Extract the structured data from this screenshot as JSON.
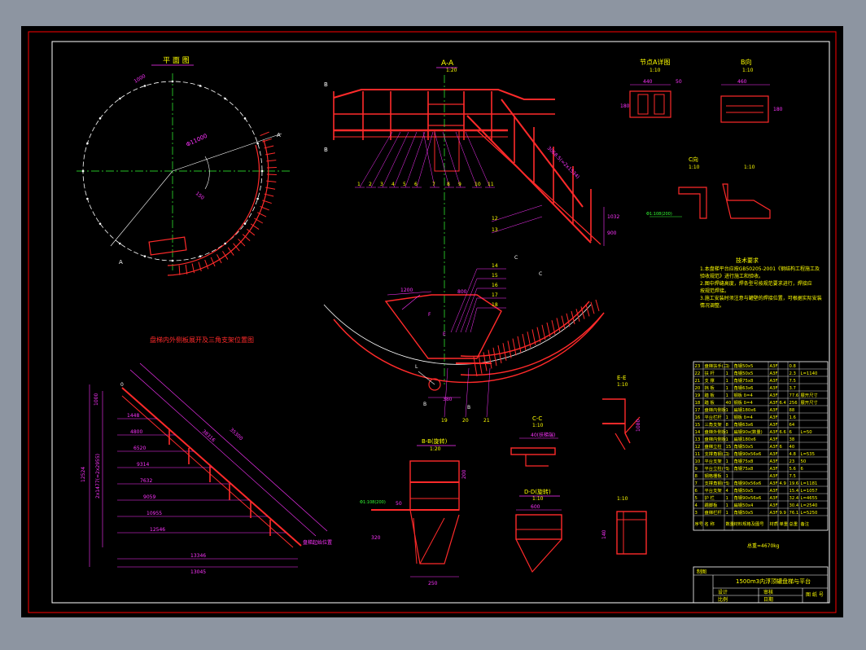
{
  "colors": {
    "background": "#000000",
    "frame": "#ff0000",
    "geometry": "#ff2a2a",
    "dimension": "#ff33ff",
    "text": "#ffff00",
    "centerline": "#33ff33",
    "leader": "#ffffff",
    "table": "#ffffff"
  },
  "views": {
    "plan_title": "平 面 图",
    "section_aa_title": "A-A",
    "section_aa_scale": "1:20",
    "node_title": "节点A详图",
    "node_scale": "1:10",
    "b_title": "B向",
    "b_scale": "1:10",
    "c_label": "C向",
    "c_scale": "1:10",
    "d_scale": "1:10",
    "unfold_title": "盘梯内外侧板展开及三角支架位置图",
    "bb_title": "B-B(旋转)",
    "bb_scale": "1:20",
    "cc_title": "C-C",
    "cc_scale": "1:10",
    "dd_title": "D-D(旋转)",
    "dd_scale": "1:10",
    "ee_title": "E-E",
    "ee_scale": "1:10",
    "f_scale": "1:10"
  },
  "notes": {
    "title": "技术要求",
    "lines": [
      "1.本盘梯平台应按GB50205-2001《钢结构工程施工及",
      "验收规范》进行施工和验收。",
      "2.图中焊缝高度，焊条型号按规范要求进行，焊接应",
      "按规范焊接。",
      "3.施工安装时须注意与罐壁的焊接位置，可根据实际安装",
      "情况调整。"
    ]
  },
  "parts_table": {
    "header": [
      "序号",
      "名 称",
      "数量",
      "材料规格及图号",
      "材质",
      "单重",
      "总重",
      "备注"
    ],
    "rows": [
      [
        "23",
        "盘梯扶手(二)",
        "1",
        "角钢50x5",
        "A3F",
        "",
        "0.8",
        ""
      ],
      [
        "22",
        "扶  杆",
        "1",
        "角钢50x5",
        "A3F",
        "",
        "2.3",
        "L=1140"
      ],
      [
        "21",
        "支  撑",
        "1",
        "角钢75x8",
        "A3F",
        "",
        "7.5",
        ""
      ],
      [
        "20",
        "挡  板",
        "1",
        "角钢63x6",
        "A3F",
        "",
        "3.7",
        ""
      ],
      [
        "19",
        "踏  板",
        "1",
        "钢板 δ=4",
        "A3F",
        "",
        "77.6",
        "展开尺寸"
      ],
      [
        "18",
        "踏  板",
        "40",
        "钢板 δ=4",
        "A3F",
        "6.4",
        "256",
        "展开尺寸"
      ],
      [
        "17",
        "盘梯内侧板",
        "1",
        "扁钢180x6",
        "A3F",
        "",
        "88",
        ""
      ],
      [
        "16",
        "平台栏杆",
        "1",
        "钢板 δ=4",
        "A3F",
        "",
        "1.6",
        ""
      ],
      [
        "15",
        "三角支架",
        "8",
        "角钢63x6",
        "A3F",
        "",
        "64",
        ""
      ],
      [
        "14",
        "盘梯外侧板",
        "1",
        "扁钢90x(数量)",
        "A3F",
        "6.6",
        "6",
        "L=50"
      ],
      [
        "13",
        "盘梯内侧板",
        "1",
        "扁钢180x6",
        "A3F",
        "",
        "38",
        ""
      ],
      [
        "12",
        "盘梯立柱",
        "15",
        "角钢50x5",
        "A3F",
        "6",
        "40",
        ""
      ],
      [
        "11",
        "支撑角钢(二)",
        "1",
        "角钢90x56x6",
        "A3F",
        "",
        "4.8",
        "L=535"
      ],
      [
        "10",
        "平台支架",
        "1",
        "角钢75x8",
        "A3F",
        "",
        "23",
        "50"
      ],
      [
        "9",
        "平台立柱(一)",
        "1",
        "角钢75x8",
        "A3F",
        "",
        "5.6",
        "6"
      ],
      [
        "8",
        "钢格栅板",
        "1",
        "",
        "A3F",
        "",
        "7.5",
        ""
      ],
      [
        "7",
        "支撑角钢(一)",
        "1",
        "角钢90x56x6",
        "A3F",
        "4.9",
        "19.6",
        "L=1181"
      ],
      [
        "6",
        "平台支架",
        "4",
        "角钢50x5",
        "A3F",
        "",
        "15.4",
        "L=1057"
      ],
      [
        "5",
        "护  栏",
        "1",
        "角钢90x56x6",
        "A3F",
        "",
        "32.4",
        "L=4655"
      ],
      [
        "4",
        "踢脚板",
        "1",
        "扁钢50x4",
        "A3F",
        "",
        "30.4",
        "L=2540"
      ],
      [
        "3",
        "盘梯栏杆",
        "1",
        "角钢50x5",
        "A3F",
        "9.9",
        "76.1",
        "L=5250"
      ]
    ],
    "total": "总重=4670kg"
  },
  "title_block": {
    "left_label": "制图",
    "drawing_title": "1500m3内浮顶罐盘梯与平台",
    "designer_label": "设计",
    "checker_label": "审核",
    "scale_label": "比例",
    "date_label": "日期",
    "drawing_no_label": "图 纸 号"
  },
  "callouts": {
    "aa_bottom": [
      "1",
      "2",
      "3",
      "4",
      "5",
      "6",
      "7",
      "8",
      "9",
      "10",
      "11"
    ],
    "aa_right": [
      "12",
      "13"
    ],
    "mid_right": [
      "14",
      "15",
      "16",
      "17",
      "18"
    ],
    "mid_bottom": [
      "19",
      "20",
      "21"
    ]
  },
  "dimensions": {
    "plan_radius": "Φ11000",
    "plan_top": "1000",
    "plan_angle": "150",
    "unfold_height": "12524",
    "unfold_rise": "2x1477(=2x2955)",
    "unfold_diag_1": "38316",
    "unfold_diag_2": "35300",
    "unfold_base_1": "13346",
    "unfold_base_2": "13045",
    "unfold_steps": [
      "1448",
      "4800",
      "6520",
      "9314",
      "7632",
      "9059",
      "10955",
      "12546"
    ],
    "unfold_note": "盘梯起始位置",
    "bb_top": "50",
    "bb_side": "200",
    "bb_bottom": "250",
    "mid_top_1": "1200",
    "mid_top_2": "800",
    "mid_bottom": "380",
    "mid_base": "Φ1:108(200)",
    "detail_left": "Φ1:108(200)"
  }
}
